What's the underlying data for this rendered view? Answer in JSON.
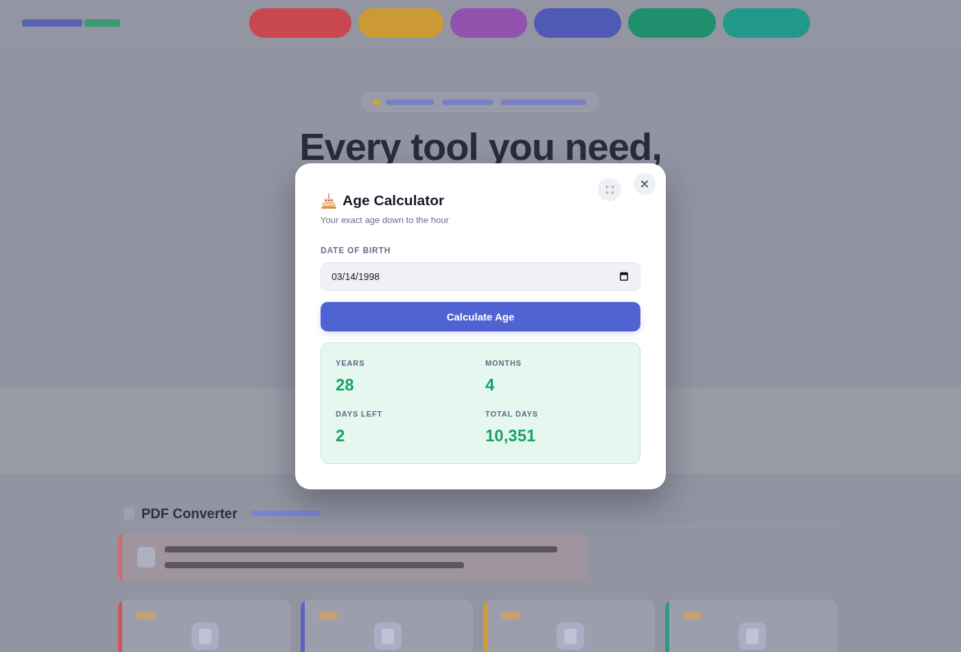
{
  "page_behind": {
    "nav": [
      {
        "color": "#c9474f"
      },
      {
        "color": "#cc9a35"
      },
      {
        "color": "#9152ad"
      },
      {
        "color": "#5059b5"
      },
      {
        "color": "#1f8f6e"
      },
      {
        "color": "#22988a"
      }
    ],
    "hero_heading": "Every tool you need,",
    "section_title": "PDF Converter",
    "cards": [
      {
        "color": "#cf5560"
      },
      {
        "color": "#5b63c2"
      },
      {
        "color": "#cf9d38"
      },
      {
        "color": "#2b9a88"
      }
    ]
  },
  "modal": {
    "title": "Age Calculator",
    "subtitle": "Your exact age down to the hour",
    "date_field": {
      "label": "DATE OF BIRTH",
      "value": "03/14/1998"
    },
    "button": "Calculate Age",
    "results": [
      {
        "label": "YEARS",
        "value": "28"
      },
      {
        "label": "MONTHS",
        "value": "4"
      },
      {
        "label": "DAYS LEFT",
        "value": "2"
      },
      {
        "label": "TOTAL DAYS",
        "value": "10,351"
      }
    ]
  }
}
